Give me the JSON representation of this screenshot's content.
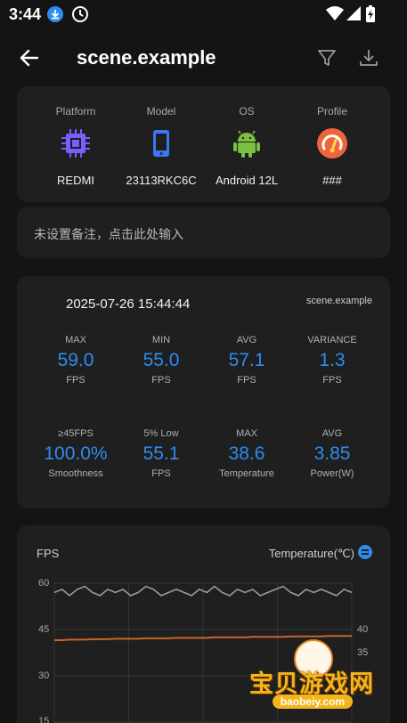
{
  "status_bar": {
    "time": "3:44"
  },
  "app_bar": {
    "title": "scene.example"
  },
  "device": {
    "columns": [
      {
        "label": "Platform",
        "value": "REDMI",
        "icon": "cpu-icon"
      },
      {
        "label": "Model",
        "value": "23113RKC6C",
        "icon": "phone-icon"
      },
      {
        "label": "OS",
        "value": "Android 12L",
        "icon": "android-icon"
      },
      {
        "label": "Profile",
        "value": "###",
        "icon": "speedometer-icon"
      }
    ]
  },
  "note": {
    "placeholder": "未设置备注，点击此处输入"
  },
  "stats": {
    "datetime": "2025-07-26 15:44:44",
    "app": "scene.example",
    "row1": [
      {
        "label": "MAX",
        "value": "59.0",
        "unit": "FPS"
      },
      {
        "label": "MIN",
        "value": "55.0",
        "unit": "FPS"
      },
      {
        "label": "AVG",
        "value": "57.1",
        "unit": "FPS"
      },
      {
        "label": "VARIANCE",
        "value": "1.3",
        "unit": "FPS"
      }
    ],
    "row2": [
      {
        "label": "≥45FPS",
        "value": "100.0%",
        "unit": "Smoothness"
      },
      {
        "label": "5% Low",
        "value": "55.1",
        "unit": "FPS"
      },
      {
        "label": "MAX",
        "value": "38.6",
        "unit": "Temperature"
      },
      {
        "label": "AVG",
        "value": "3.85",
        "unit": "Power(W)"
      }
    ],
    "accent_color": "#2e8cf0"
  },
  "chart": {
    "left_title": "FPS",
    "right_title": "Temperature(℃)",
    "fps_ticks": [
      "60",
      "45",
      "30",
      "15"
    ],
    "temp_ticks": [
      "40",
      "35"
    ],
    "fps_color": "#9a9a9a",
    "temp_color": "#c8662a"
  },
  "chart_data": {
    "type": "line",
    "x": [
      0,
      1,
      2,
      3,
      4,
      5,
      6,
      7,
      8,
      9,
      10,
      11,
      12,
      13,
      14,
      15,
      16,
      17,
      18,
      19,
      20,
      21,
      22,
      23,
      24,
      25,
      26,
      27,
      28,
      29,
      30,
      31,
      32,
      33,
      34,
      35,
      36,
      37,
      38,
      39
    ],
    "series": [
      {
        "name": "FPS",
        "axis": "left",
        "values": [
          57,
          58,
          56,
          58,
          59,
          57,
          56,
          58,
          57,
          58,
          56,
          57,
          59,
          58,
          56,
          57,
          58,
          57,
          56,
          58,
          57,
          59,
          57,
          56,
          58,
          57,
          58,
          56,
          57,
          58,
          59,
          57,
          56,
          58,
          57,
          58,
          57,
          56,
          58,
          57
        ]
      },
      {
        "name": "Temperature",
        "axis": "right",
        "values": [
          37.7,
          37.7,
          37.8,
          37.8,
          37.8,
          37.9,
          37.9,
          37.9,
          38.0,
          38.0,
          38.0,
          38.0,
          38.1,
          38.1,
          38.1,
          38.1,
          38.2,
          38.2,
          38.2,
          38.2,
          38.2,
          38.3,
          38.3,
          38.3,
          38.3,
          38.3,
          38.4,
          38.4,
          38.4,
          38.4,
          38.4,
          38.5,
          38.5,
          38.5,
          38.5,
          38.5,
          38.6,
          38.6,
          38.6,
          38.6
        ]
      }
    ],
    "left_axis": {
      "label": "FPS",
      "ticks": [
        60,
        45,
        30,
        15
      ],
      "ylim": [
        0,
        60
      ]
    },
    "right_axis": {
      "label": "Temperature(℃)",
      "ticks": [
        40,
        35
      ]
    },
    "grid": true
  },
  "watermark": {
    "text": "宝贝游戏网",
    "sub": "baobeiy.com"
  }
}
